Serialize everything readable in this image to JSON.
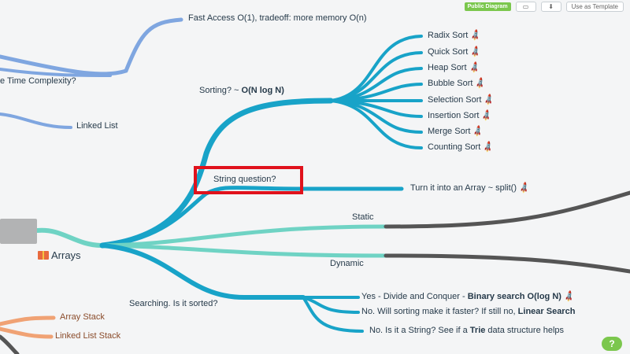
{
  "toolbar": {
    "badge": "Public Diagram",
    "template_label": "Use as Template"
  },
  "top_nodes": {
    "fast_access": "Fast Access O(1), tradeoff: more memory O(n)",
    "time_complexity": "e Time Complexity?",
    "linked_list": "Linked List"
  },
  "root": {
    "label": "Arrays",
    "icon": "gift-icon"
  },
  "sorting": {
    "label_prefix": "Sorting? ~ ",
    "label_bold": "O(N log N)",
    "items": [
      "Radix Sort",
      "Quick Sort",
      "Heap Sort",
      "Bubble Sort",
      "Selection Sort",
      "Insertion Sort",
      "Merge Sort",
      "Counting Sort"
    ]
  },
  "string": {
    "label": "String question?",
    "answer": "Turn it into an Array ~ split()"
  },
  "static_label": "Static",
  "dynamic_label": "Dynamic",
  "searching": {
    "label": "Searching. Is it sorted?",
    "answers": [
      {
        "prefix": "Yes - Divide and Conquer - ",
        "bold": "Binary search O(log N)",
        "suffix": ""
      },
      {
        "prefix": "No. Will sorting make it faster? If still no, ",
        "bold": "Linear Search",
        "suffix": ""
      },
      {
        "prefix": "No. Is it a String? See if a ",
        "bold": "Trie",
        "suffix": " data structure helps"
      }
    ]
  },
  "stack": {
    "array_stack": "Array Stack",
    "linked_list_stack": "Linked List Stack"
  },
  "help_label": "?",
  "colors": {
    "teal_branch": "#18a3c8",
    "light_teal": "#6fd3c4",
    "blue_branch": "#7fa6e0",
    "orange_branch": "#f0a274",
    "dark_branch": "#555555",
    "highlight": "#e0121c"
  }
}
